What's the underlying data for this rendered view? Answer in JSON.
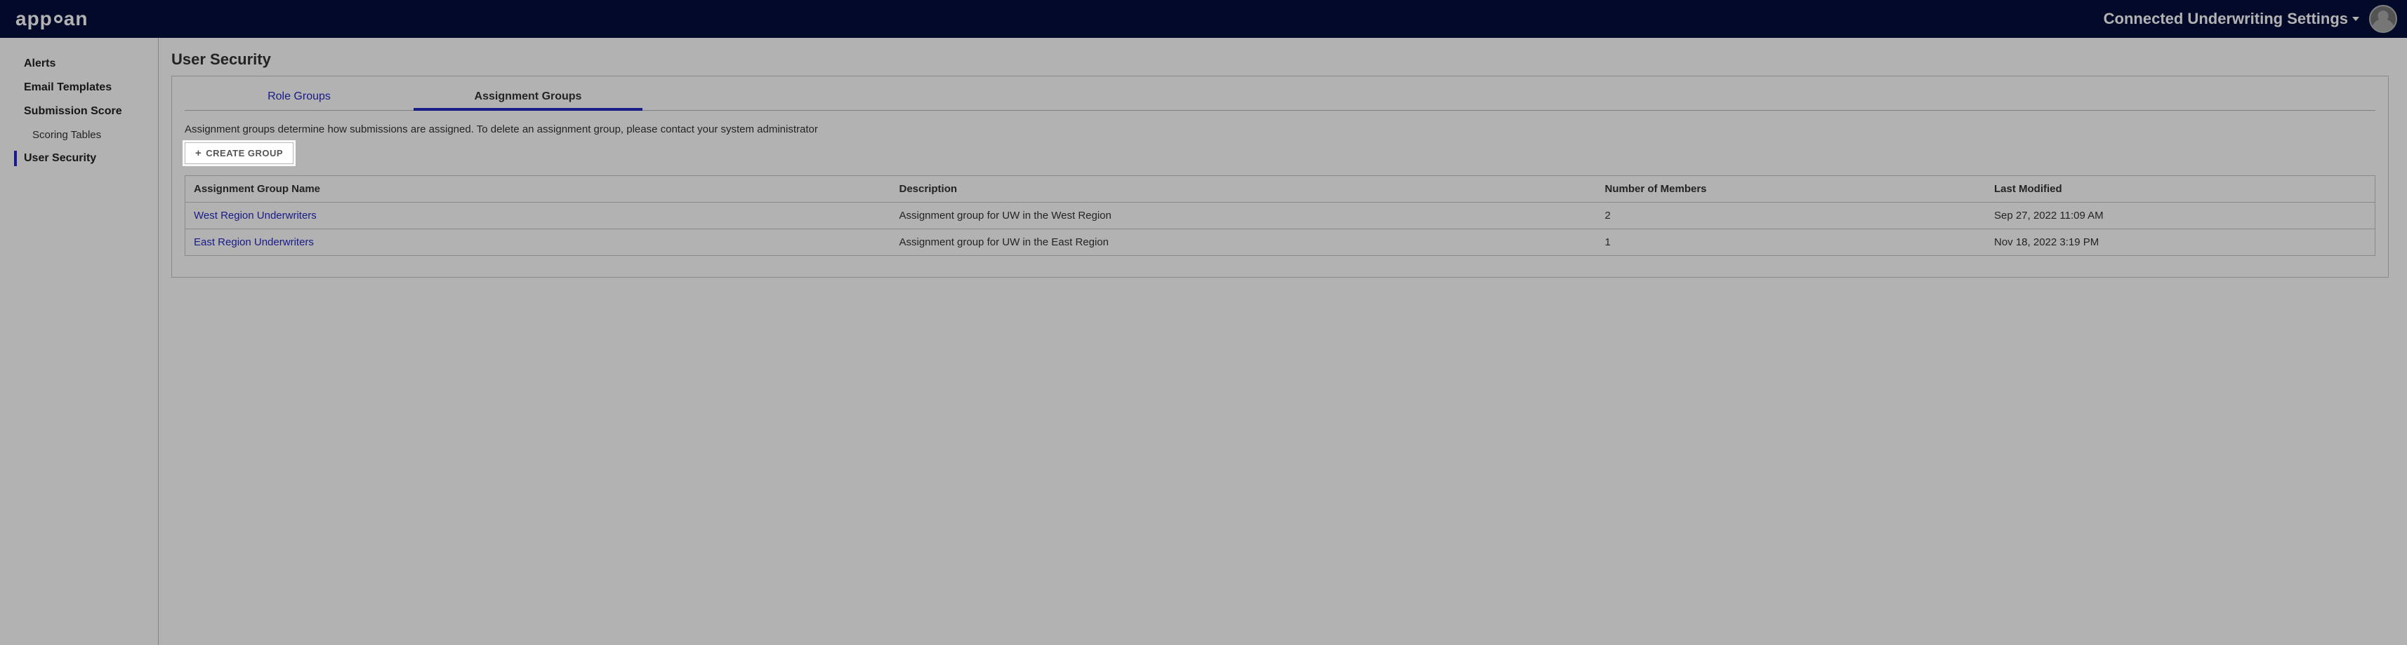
{
  "header": {
    "logo_text_1": "app",
    "logo_text_2": "an",
    "title": "Connected Underwriting Settings"
  },
  "sidebar": {
    "items": [
      {
        "label": "Alerts",
        "type": "item"
      },
      {
        "label": "Email Templates",
        "type": "item"
      },
      {
        "label": "Submission Score",
        "type": "item"
      },
      {
        "label": "Scoring Tables",
        "type": "subitem"
      },
      {
        "label": "User Security",
        "type": "item",
        "active": true
      }
    ]
  },
  "page": {
    "title": "User Security",
    "tabs": [
      {
        "label": "Role Groups",
        "active": false
      },
      {
        "label": "Assignment Groups",
        "active": true
      }
    ],
    "description": "Assignment groups determine how submissions are assigned. To delete an assignment group, please contact your system administrator",
    "create_button": "CREATE GROUP"
  },
  "table": {
    "headers": [
      "Assignment Group Name",
      "Description",
      "Number of Members",
      "Last Modified"
    ],
    "rows": [
      {
        "name": "West Region Underwriters",
        "desc": "Assignment group for UW in the West Region",
        "members": "2",
        "modified": "Sep 27, 2022 11:09 AM"
      },
      {
        "name": "East Region Underwriters",
        "desc": "Assignment group for UW in the East Region",
        "members": "1",
        "modified": "Nov 18, 2022 3:19 PM"
      }
    ]
  }
}
